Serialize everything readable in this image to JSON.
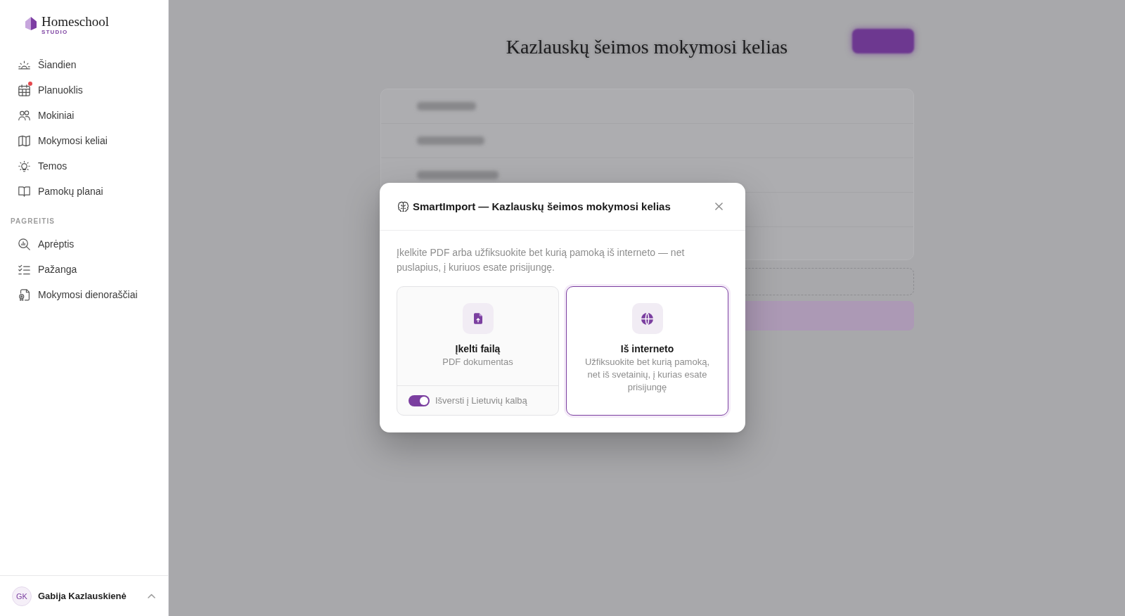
{
  "sidebar": {
    "logo": {
      "name": "Homeschool",
      "tagline": "STUDIO"
    },
    "nav_items": [
      {
        "label": "Šiandien",
        "selected": false,
        "notification": false
      },
      {
        "label": "Planuoklis",
        "selected": false,
        "notification": true
      },
      {
        "label": "Mokiniai",
        "selected": false,
        "notification": false
      },
      {
        "label": "Mokymosi keliai",
        "selected": false,
        "notification": false
      },
      {
        "label": "Temos",
        "selected": false,
        "notification": false
      },
      {
        "label": "Pamokų planai",
        "selected": false,
        "notification": false
      }
    ],
    "section": {
      "heading": "PAGREITIS",
      "items": [
        {
          "label": "Aprėptis",
          "selected": false
        },
        {
          "label": "Pažanga",
          "selected": false
        },
        {
          "label": "Mokymosi dienoraščiai",
          "selected": false
        }
      ]
    },
    "user": {
      "initials": "GK",
      "name": "Gabija Kazlauskienė"
    }
  },
  "page": {
    "title": "Kazlauskų šeimos mokymosi kelias"
  },
  "dialog": {
    "title": "SmartImport — Kazlauskų šeimos mokymosi kelias",
    "description": "Įkelkite PDF arba užfiksuokite bet kurią pamoką iš interneto — net puslapius, į kuriuos esate prisijungę.",
    "options": [
      {
        "kind": "file",
        "title": "Įkelti failą",
        "subtitle": "PDF dokumentas",
        "selected": false,
        "toggle": {
          "label": "Išversti į Lietuvių kalbą",
          "on": true
        }
      },
      {
        "kind": "web",
        "title": "Iš interneto",
        "subtitle": "Užfiksuokite bet kurią pamoką, net iš svetainių, į kurias esate prisijungę",
        "selected": true
      }
    ]
  }
}
